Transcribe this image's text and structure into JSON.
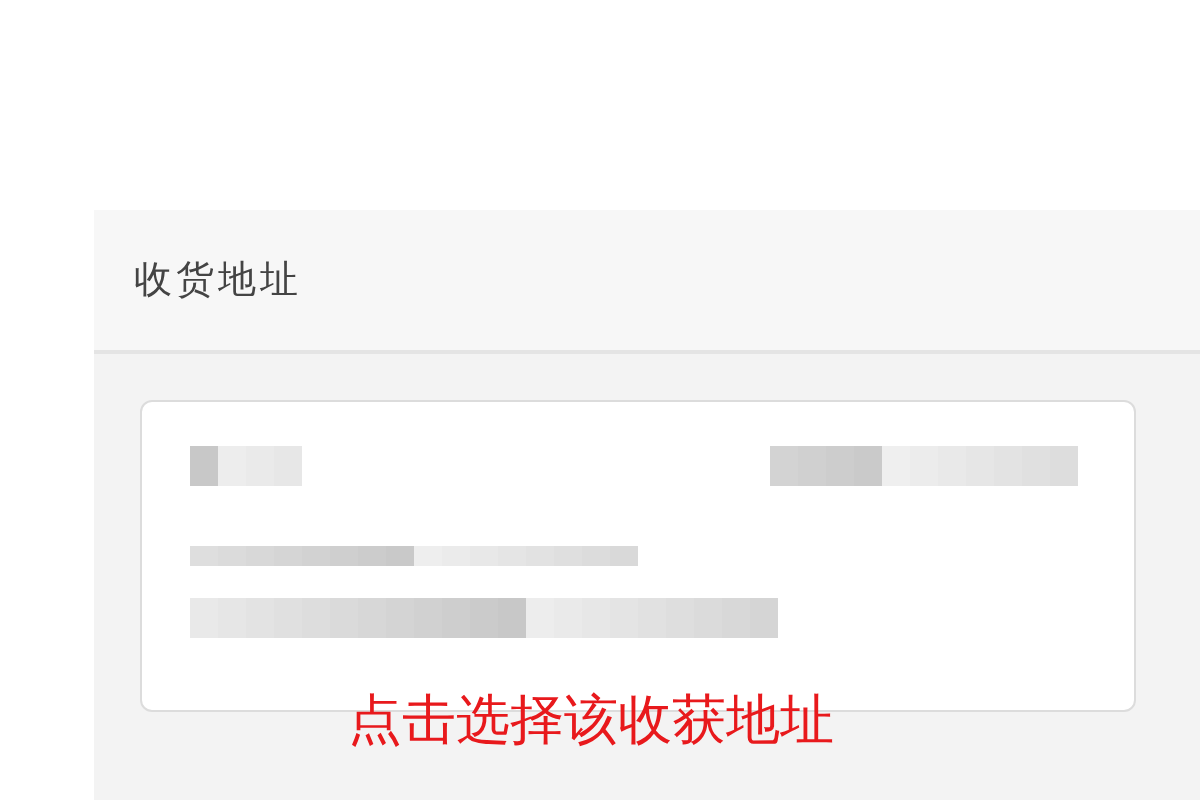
{
  "panel": {
    "title": "收货地址"
  },
  "address_card": {
    "kind": "blurred"
  },
  "annotation": {
    "text": "点击选择该收获地址"
  }
}
